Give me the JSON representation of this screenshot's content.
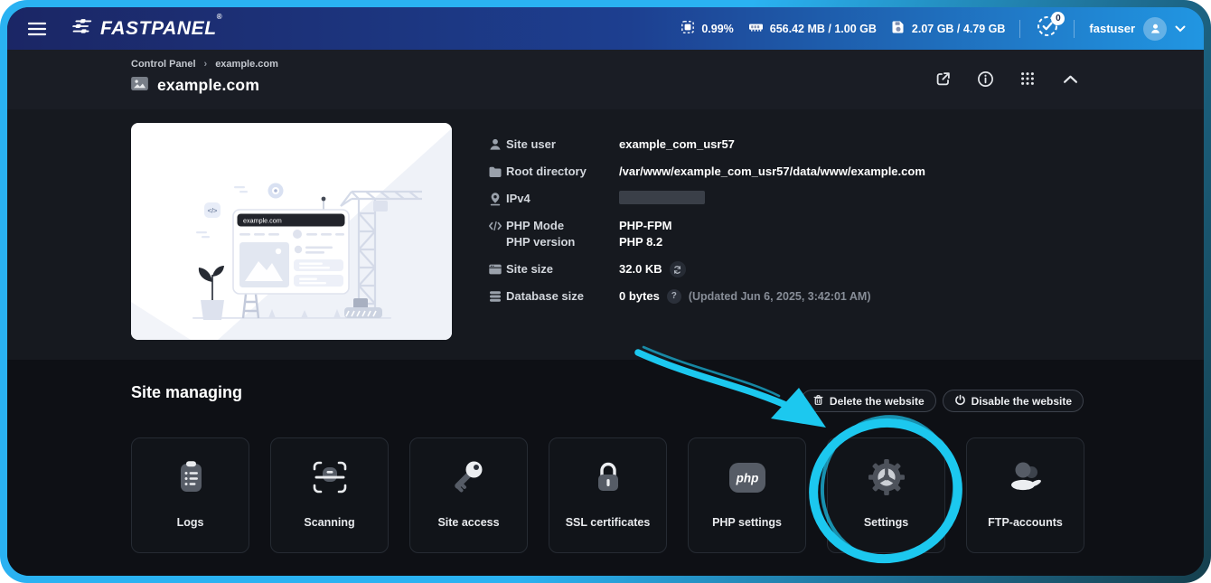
{
  "colors": {
    "frame_cyan": "#2ab2f2",
    "topbar_left": "#1b2665",
    "topbar_right": "#2196e2",
    "annotation_cyan": "#1cc8ef"
  },
  "topbar": {
    "logo_text": "FASTPANEL",
    "logo_reg": "®",
    "stats": [
      {
        "name": "cpu",
        "value": "0.99%"
      },
      {
        "name": "ram",
        "value": "656.42 MB / 1.00 GB"
      },
      {
        "name": "disk",
        "value": "2.07 GB / 4.79 GB"
      }
    ],
    "tasks_badge": "0",
    "username": "fastuser"
  },
  "header": {
    "breadcrumb": {
      "items": [
        "Control Panel",
        "example.com"
      ],
      "separator": "›"
    },
    "title": "example.com"
  },
  "site_info": {
    "rows": {
      "site_user": {
        "label": "Site user",
        "value": "example_com_usr57"
      },
      "root_directory": {
        "label": "Root directory",
        "value": "/var/www/example_com_usr57/data/www/example.com"
      },
      "ipv4": {
        "label": "IPv4"
      },
      "php": {
        "label": "PHP Mode",
        "label2": "PHP version",
        "value": "PHP-FPM",
        "value2": "PHP 8.2"
      },
      "site_size": {
        "label": "Site size",
        "value": "32.0 KB"
      },
      "database_size": {
        "label": "Database size",
        "value": "0 bytes",
        "help": "?",
        "note": "(Updated Jun 6, 2025, 3:42:01 AM)"
      }
    },
    "illustration": {
      "domain": "example.com",
      "code_badge": "</>"
    }
  },
  "site_managing": {
    "title": "Site managing",
    "actions": [
      {
        "label": "Delete the website"
      },
      {
        "label": "Disable the website"
      }
    ],
    "cards": [
      {
        "label": "Logs"
      },
      {
        "label": "Scanning"
      },
      {
        "label": "Site access"
      },
      {
        "label": "SSL certificates"
      },
      {
        "label": "PHP settings"
      },
      {
        "label": "Settings",
        "highlighted": true
      },
      {
        "label": "FTP-accounts"
      }
    ],
    "php_icon_text": "php"
  }
}
